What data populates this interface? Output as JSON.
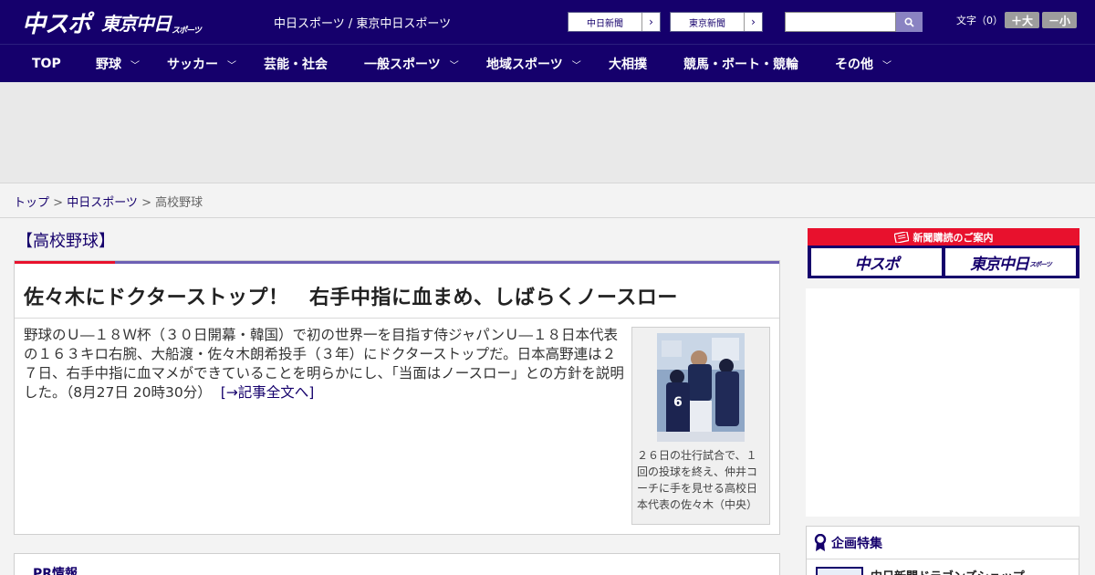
{
  "header": {
    "logo_main": "中スポ",
    "logo_sub": "東京中日",
    "logo_sub_small": "スポーツ",
    "sites_text": "中日スポーツ / 東京中日スポーツ",
    "btn_chunichi": "中日新聞",
    "btn_tokyo": "東京新聞",
    "search_placeholder": "",
    "fontsize_label": "文字（0）",
    "fontsize_up": "＋大",
    "fontsize_down": "－小"
  },
  "nav": {
    "items": [
      {
        "label": "TOP"
      },
      {
        "label": "野球"
      },
      {
        "label": "サッカー"
      },
      {
        "label": "芸能・社会"
      },
      {
        "label": "一般スポーツ"
      },
      {
        "label": "地域スポーツ"
      },
      {
        "label": "大相撲"
      },
      {
        "label": "競馬・ボート・競輪"
      },
      {
        "label": "その他"
      }
    ]
  },
  "breadcrumb": {
    "home": "トップ",
    "sep": " > ",
    "section": "中日スポーツ",
    "current": "高校野球"
  },
  "article": {
    "category": "【高校野球】",
    "title": "佐々木にドクターストップ！　右手中指に血まめ、しばらくノースロー",
    "body": "野球のＵ―１８Ｗ杯（３０日開幕・韓国）で初の世界一を目指す侍ジャパンＵ―１８日本代表の１６３キロ右腕、大船渡・佐々木朗希投手（３年）にドクターストップだ。日本高野連は２７日、右手中指に血マメができていることを明らかにし、「当面はノースロー」との方針を説明した。（8月27日 20時30分）",
    "more_link": "[→記事全文へ]",
    "photo_caption": "２６日の壮行試合で、１回の投球を終え、仲井コーチに手を見せる高校日本代表の佐々木（中央）"
  },
  "pr": {
    "title": "PR情報"
  },
  "sidebar": {
    "subscribe_label": "新聞購読のご案内",
    "logo_chuspo": "中スポ",
    "logo_tokyo": "東京中日",
    "logo_tokyo_small": "スポーツ",
    "feature_title": "企画特集",
    "feature_item": "中日新聞ドラゴンズショップ"
  },
  "colors": {
    "brand": "#15006c",
    "accent_red": "#e8112d"
  }
}
